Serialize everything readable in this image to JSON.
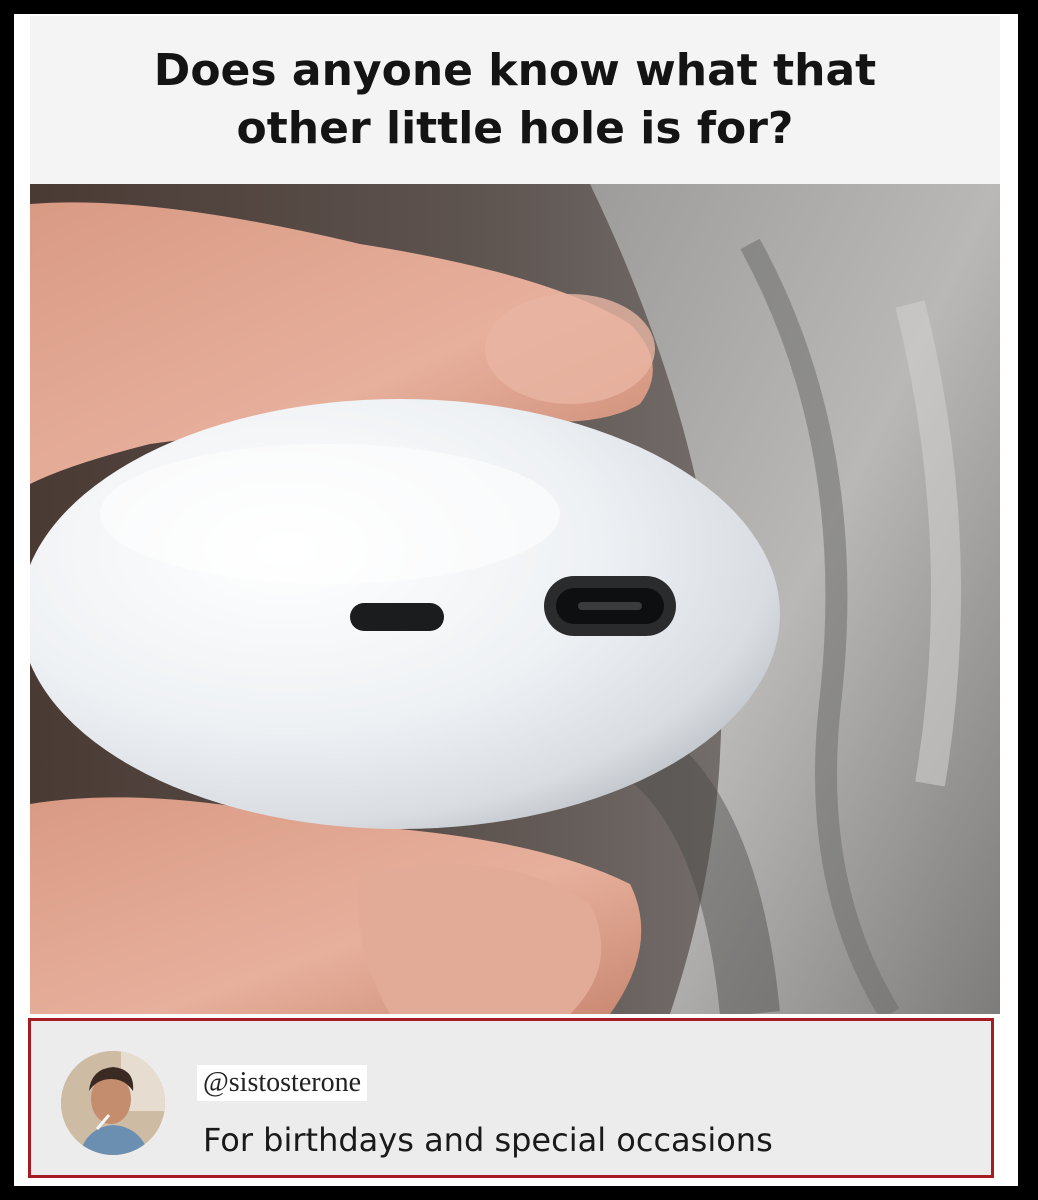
{
  "post": {
    "title": "Does anyone know what that other little hole is for?"
  },
  "reply": {
    "handle": "@sistosterone",
    "text": "For birthdays and special occasions"
  },
  "colors": {
    "frame": "#000000",
    "reply_border": "#a51c22",
    "reply_background": "#ececec",
    "case_white": "#f2f4f6"
  }
}
